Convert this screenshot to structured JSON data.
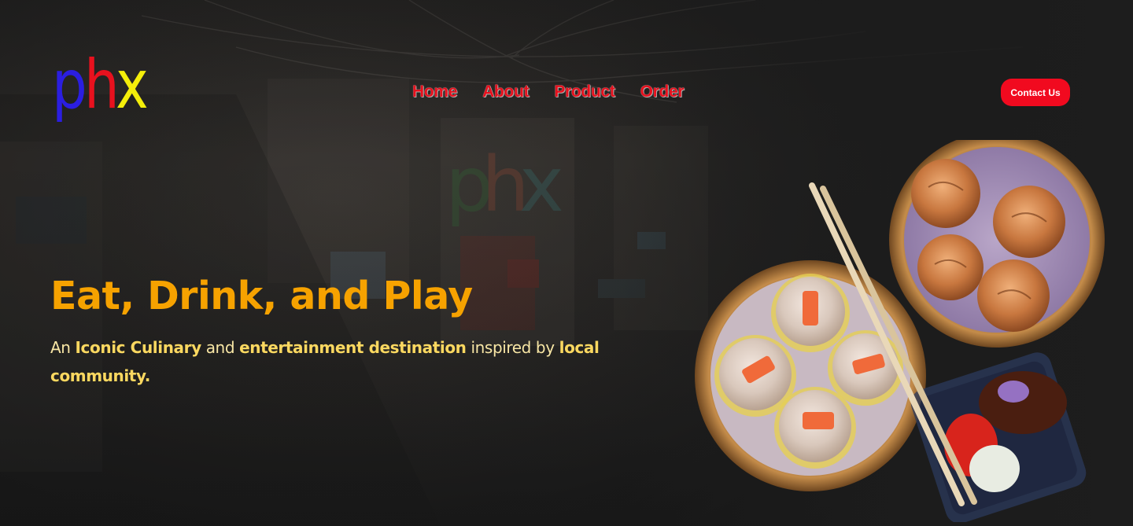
{
  "brand": {
    "logo_letters": [
      "p",
      "h",
      "x"
    ],
    "colors": {
      "p": "#2b1ee0",
      "h": "#e8111e",
      "x": "#f4ee0a"
    }
  },
  "nav": {
    "items": [
      {
        "label": "Home"
      },
      {
        "label": "About"
      },
      {
        "label": "Product"
      },
      {
        "label": "Order"
      }
    ],
    "color": "#e7101d"
  },
  "header": {
    "contact_label": "Contact Us",
    "contact_color": "#f10a1f"
  },
  "hero": {
    "title": "Eat, Drink, and Play",
    "title_color": "#f6a200",
    "subtitle": {
      "part1": "An ",
      "bold1": "Iconic Culinary",
      "part2": " and ",
      "bold2": "entertainment destination",
      "part3": " inspired by ",
      "bold3": "local community."
    }
  },
  "illustration": {
    "subject": "dim-sum-steamer-baskets-with-chopsticks-and-sauce"
  }
}
